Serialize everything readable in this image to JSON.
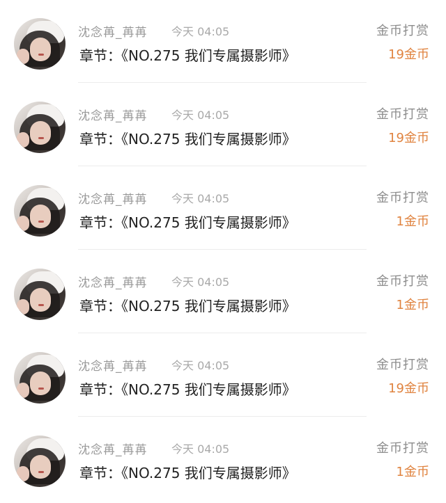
{
  "rewards": [
    {
      "username": "沈念苒_苒苒",
      "time": "今天 04:05",
      "chapter": "章节：《NO.275  我们专属摄影师》",
      "action": "金币打赏",
      "coins": "19金币"
    },
    {
      "username": "沈念苒_苒苒",
      "time": "今天 04:05",
      "chapter": "章节：《NO.275  我们专属摄影师》",
      "action": "金币打赏",
      "coins": "19金币"
    },
    {
      "username": "沈念苒_苒苒",
      "time": "今天 04:05",
      "chapter": "章节：《NO.275  我们专属摄影师》",
      "action": "金币打赏",
      "coins": "1金币"
    },
    {
      "username": "沈念苒_苒苒",
      "time": "今天 04:05",
      "chapter": "章节：《NO.275  我们专属摄影师》",
      "action": "金币打赏",
      "coins": "1金币"
    },
    {
      "username": "沈念苒_苒苒",
      "time": "今天 04:05",
      "chapter": "章节：《NO.275  我们专属摄影师》",
      "action": "金币打赏",
      "coins": "19金币"
    },
    {
      "username": "沈念苒_苒苒",
      "time": "今天 04:05",
      "chapter": "章节：《NO.275  我们专属摄影师》",
      "action": "金币打赏",
      "coins": "1金币"
    }
  ],
  "colors": {
    "coins": "#e0833f",
    "username": "#9a9a9a",
    "chapter": "#222222",
    "action": "#8d8d8d"
  },
  "icons": {
    "avatar": "user-avatar-photo"
  }
}
